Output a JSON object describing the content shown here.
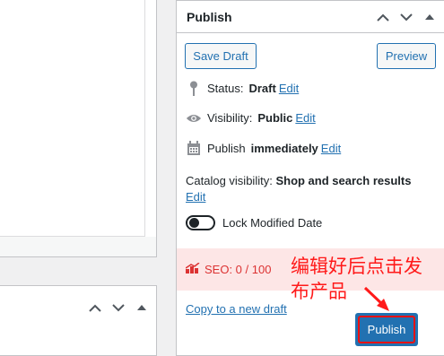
{
  "publish_box": {
    "title": "Publish",
    "save_draft_label": "Save Draft",
    "preview_label": "Preview",
    "status_label": "Status:",
    "status_value": "Draft",
    "visibility_label": "Visibility:",
    "visibility_value": "Public",
    "publish_label": "Publish",
    "publish_value": "immediately",
    "edit_label": "Edit",
    "catalog_label": "Catalog visibility:",
    "catalog_value": "Shop and search results",
    "lock_label": "Lock Modified Date",
    "seo_label": "SEO: 0 / 100",
    "copy_link": "Copy to a new draft",
    "publish_button": "Publish"
  },
  "annotation": {
    "text": "编辑好后点击发布产品"
  },
  "colors": {
    "accent": "#2271b1",
    "seo_bg": "#fde6e6",
    "seo_text": "#dc3232",
    "annotation": "#ff1a1a"
  },
  "icons": [
    "chevron-up-icon",
    "chevron-down-icon",
    "toggle-arrow-icon",
    "pin-icon",
    "eye-icon",
    "calendar-icon",
    "seo-chart-icon",
    "arrow-annotation-icon"
  ]
}
